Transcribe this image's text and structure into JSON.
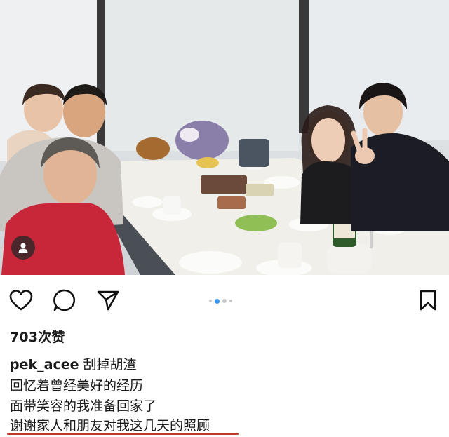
{
  "post": {
    "likes_text": "703次赞",
    "username": "pek_acee",
    "caption_first": "刮掉胡渣",
    "caption_lines": [
      "回忆着曾经美好的经历",
      "面带笑容的我准备回家了",
      "谢谢家人和朋友对我这几天的照顾"
    ],
    "carousel": {
      "count": 4,
      "active_index": 1
    }
  },
  "icons": {
    "like": "heart-icon",
    "comment": "comment-bubble-icon",
    "share": "paper-plane-icon",
    "save": "bookmark-icon",
    "tag": "user-tag-icon"
  },
  "colors": {
    "active_dot": "#3897f0",
    "underline": "#c0392b"
  }
}
